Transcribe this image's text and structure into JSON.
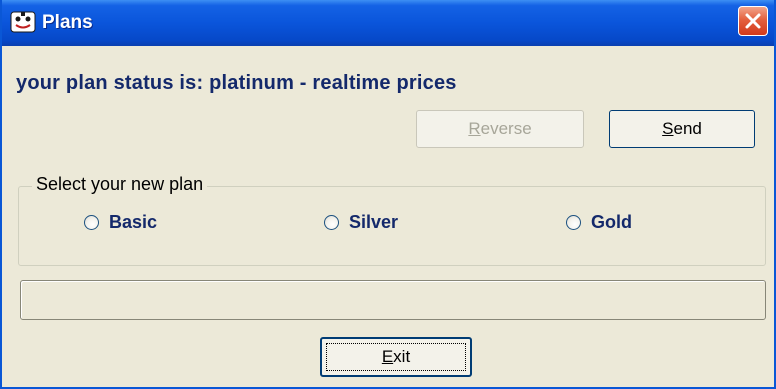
{
  "window": {
    "title": "Plans"
  },
  "status": {
    "text": "your plan status is: platinum - realtime prices"
  },
  "buttons": {
    "reverse_first": "R",
    "reverse_rest": "everse",
    "send_first": "S",
    "send_rest": "end",
    "exit_first": "E",
    "exit_rest": "xit"
  },
  "plan_group": {
    "legend": "Select your new plan",
    "options": [
      {
        "label": "Basic",
        "selected": false
      },
      {
        "label": "Silver",
        "selected": false
      },
      {
        "label": "Gold",
        "selected": false
      }
    ]
  },
  "icons": {
    "app": "app-face-icon",
    "close": "close-icon"
  },
  "colors": {
    "titlebar": "#0a55db",
    "status_text": "#14296b",
    "close_button": "#d2391b",
    "background": "#ece9d8"
  }
}
